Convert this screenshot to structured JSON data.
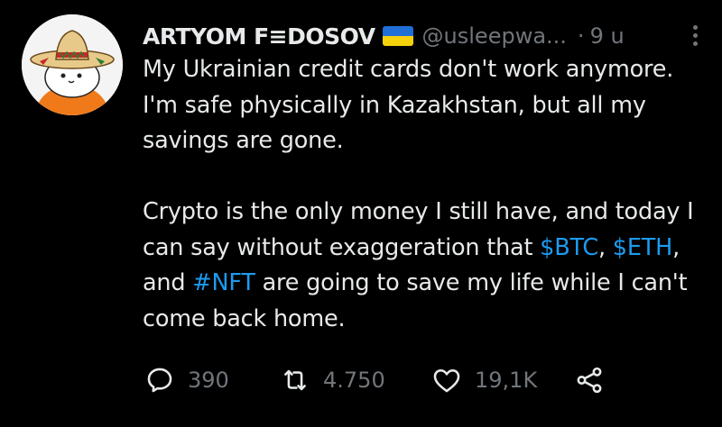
{
  "author": {
    "display_name": "ARTYOM F≡DOSOV",
    "handle": "@usleepwa...",
    "separator": "·",
    "time": "9 u",
    "flag": "flag-ukraine-icon"
  },
  "tweet": {
    "paragraph1": "My Ukrainian credit cards don't work anymore. I'm safe physically in Kazakhstan, but all my savings are gone.",
    "paragraph2_start": "Crypto is the only money I still have, and today I can say without exaggeration that",
    "cashtag1": "$BTC",
    "sep1": ",",
    "cashtag2": "$ETH",
    "sep2": ", and",
    "hashtag": "#NFT",
    "paragraph2_end": "are going to save my life while I can't come back home."
  },
  "actions": {
    "replies": "390",
    "retweets": "4.750",
    "likes": "19,1K"
  },
  "colors": {
    "background": "#000000",
    "text": "#e7e9ea",
    "muted": "#71767b",
    "link": "#1d9bf0",
    "flag_blue": "#1f6fd6",
    "flag_yellow": "#f5d10b"
  }
}
